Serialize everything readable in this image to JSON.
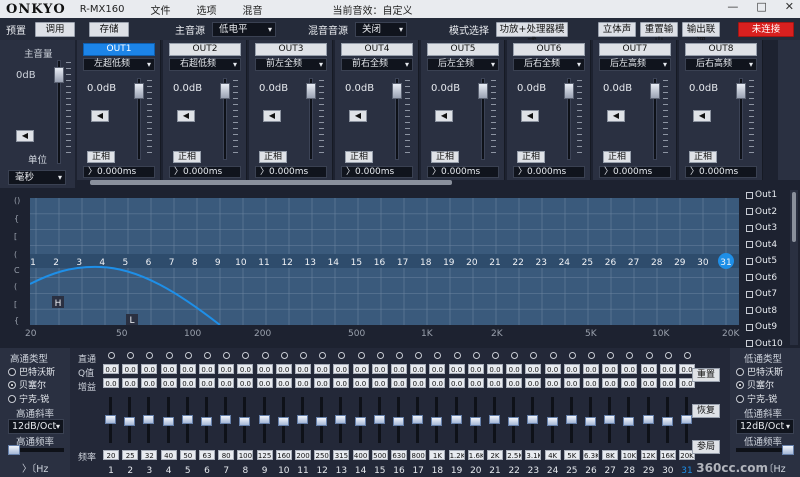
{
  "menubar": {
    "logo": "ONKYO",
    "model": "R-MX160",
    "items": [
      "文件",
      "选项",
      "混音"
    ],
    "preset_label": "当前音效：自定义",
    "controls": [
      "—",
      "□",
      "✕"
    ]
  },
  "toolbar": {
    "preset_label": "预置",
    "call_button": "调用",
    "save_button": "存储",
    "main_source_label": "主音源",
    "main_source_value": "低电平",
    "mix_source_label": "混音音源",
    "mix_source_value": "关闭",
    "mode_label": "模式选择",
    "mode_value": "功放+处理器模式",
    "stereo_button": "立体声",
    "reset_output_button": "重置输出",
    "output_link_button": "输出联调",
    "connect_button": "未连接"
  },
  "master": {
    "title": "主音量",
    "db": "0dB",
    "unit_label": "单位",
    "unit_value": "毫秒"
  },
  "outputs": [
    {
      "name": "OUT1",
      "filter": "左超低频",
      "db": "0.0dB",
      "phase": "正相",
      "delay": "0.000ms",
      "active": true
    },
    {
      "name": "OUT2",
      "filter": "右超低频",
      "db": "0.0dB",
      "phase": "正相",
      "delay": "0.000ms",
      "active": false
    },
    {
      "name": "OUT3",
      "filter": "前左全频",
      "db": "0.0dB",
      "phase": "正相",
      "delay": "0.000ms",
      "active": false
    },
    {
      "name": "OUT4",
      "filter": "前右全频",
      "db": "0.0dB",
      "phase": "正相",
      "delay": "0.000ms",
      "active": false
    },
    {
      "name": "OUT5",
      "filter": "后左全频",
      "db": "0.0dB",
      "phase": "正相",
      "delay": "0.000ms",
      "active": false
    },
    {
      "name": "OUT6",
      "filter": "后右全频",
      "db": "0.0dB",
      "phase": "正相",
      "delay": "0.000ms",
      "active": false
    },
    {
      "name": "OUT7",
      "filter": "后左高频",
      "db": "0.0dB",
      "phase": "正相",
      "delay": "0.000ms",
      "active": false
    },
    {
      "name": "OUT8",
      "filter": "后右高频",
      "db": "0.0dB",
      "phase": "正相",
      "delay": "0.000ms",
      "active": false
    }
  ],
  "graph": {
    "xlabels": [
      "20",
      "50",
      "100",
      "200",
      "500",
      "1K",
      "2K",
      "5K",
      "10K",
      "20K"
    ],
    "ylabels": [
      "()",
      "{",
      "[",
      "(",
      "C",
      "(",
      "[",
      "{"
    ],
    "band_numbers": [
      "1",
      "2",
      "3",
      "4",
      "5",
      "6",
      "7",
      "8",
      "9",
      "10",
      "11",
      "12",
      "13",
      "14",
      "15",
      "16",
      "17",
      "18",
      "19",
      "20",
      "21",
      "22",
      "23",
      "24",
      "25",
      "26",
      "27",
      "28",
      "29",
      "30",
      "31"
    ],
    "highpass_marker": "H",
    "lowpass_marker": "L",
    "legend": [
      "Out1",
      "Out2",
      "Out3",
      "Out4",
      "Out5",
      "Out6",
      "Out7",
      "Out8",
      "Out9",
      "Out10"
    ]
  },
  "crossover_left": {
    "type_title": "高通类型",
    "options": [
      "巴特沃斯",
      "贝塞尔",
      "宁克-锐"
    ],
    "selected": 1,
    "slope_title": "高通斜率",
    "slope_value": "12dB/Oct",
    "freq_title": "高通频率",
    "freq_value": "〉〔Hz"
  },
  "crossover_right": {
    "type_title": "低通类型",
    "options": [
      "巴特沃斯",
      "贝塞尔",
      "宁克-锐"
    ],
    "selected": 1,
    "slope_title": "低通斜率",
    "slope_value": "12dB/Oct",
    "freq_title": "低通频率",
    "freq_value": "〔Hz"
  },
  "eq": {
    "row_labels": [
      "直通",
      "Q值",
      "增益",
      "频率"
    ],
    "q_value": "0.0",
    "gain_value": "0.0",
    "freq_values": [
      "20",
      "25",
      "32",
      "40",
      "50",
      "63",
      "80",
      "100",
      "125",
      "160",
      "200",
      "250",
      "315",
      "400",
      "500",
      "630",
      "800",
      "1K",
      "1.2K",
      "1.6K",
      "2K",
      "2.5K",
      "3.1K",
      "4K",
      "5K",
      "6.3K",
      "8K",
      "10K",
      "12K",
      "16K",
      "20K"
    ],
    "channels": [
      "1",
      "2",
      "3",
      "4",
      "5",
      "6",
      "7",
      "8",
      "9",
      "10",
      "11",
      "12",
      "13",
      "14",
      "15",
      "16",
      "17",
      "18",
      "19",
      "20",
      "21",
      "22",
      "23",
      "24",
      "25",
      "26",
      "27",
      "28",
      "29",
      "30",
      "31"
    ],
    "reset_button": "重置",
    "restore_button": "恢复",
    "param_button": "参局"
  },
  "watermark": "360cc.com",
  "colors": {
    "accent": "#1c84e8",
    "alert": "#d9201f",
    "graph_bg": "#3a5a7c",
    "curve": "#1e8fe8"
  }
}
